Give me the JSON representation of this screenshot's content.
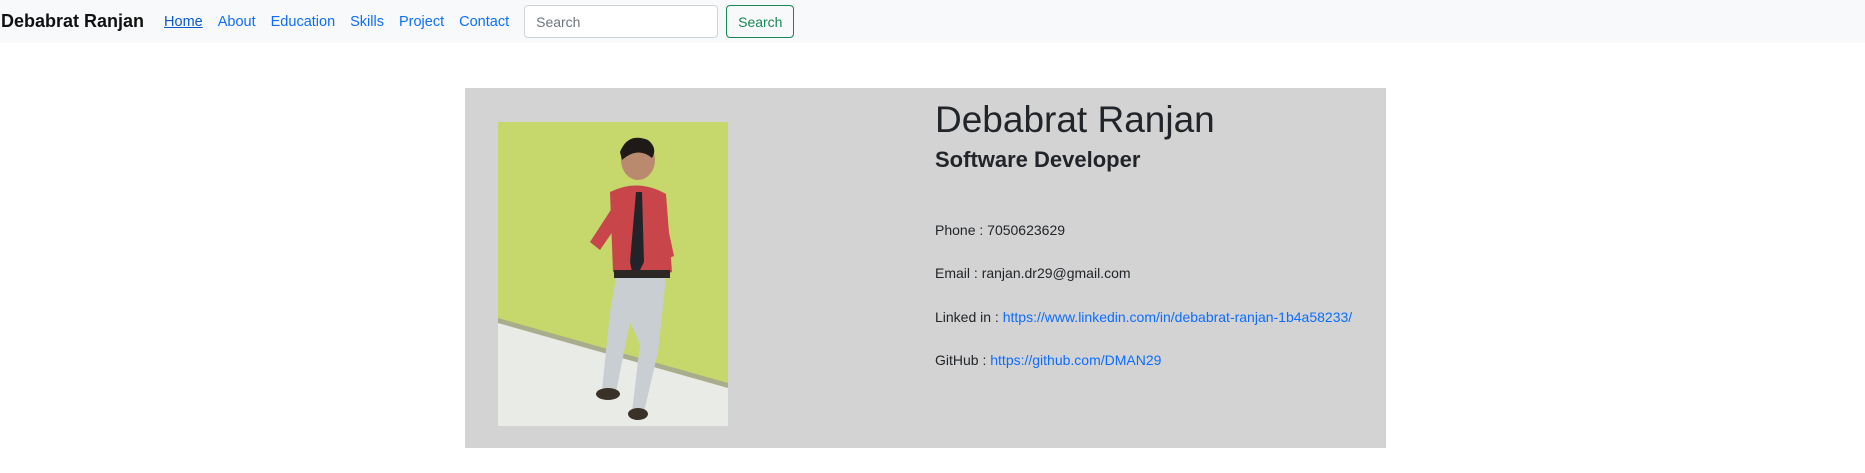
{
  "navbar": {
    "brand": "Debabrat Ranjan",
    "links": [
      {
        "label": "Home",
        "active": true
      },
      {
        "label": "About"
      },
      {
        "label": "Education"
      },
      {
        "label": "Skills"
      },
      {
        "label": "Project"
      },
      {
        "label": "Contact"
      }
    ],
    "search_placeholder": "Search",
    "search_button": "Search"
  },
  "profile": {
    "name": "Debabrat Ranjan",
    "title": "Software Developer",
    "phone_label": "Phone : ",
    "phone": "7050623629",
    "email_label": "Email : ",
    "email": "ranjan.dr29@gmail.com",
    "linkedin_label": "Linked in : ",
    "linkedin": "https://www.linkedin.com/in/debabrat-ranjan-1b4a58233/",
    "github_label": "GitHub : ",
    "github": "https://github.com/DMAN29"
  },
  "colors": {
    "link": "#0d6efd",
    "card_bg": "#d3d3d3",
    "search_button": "#198754"
  }
}
